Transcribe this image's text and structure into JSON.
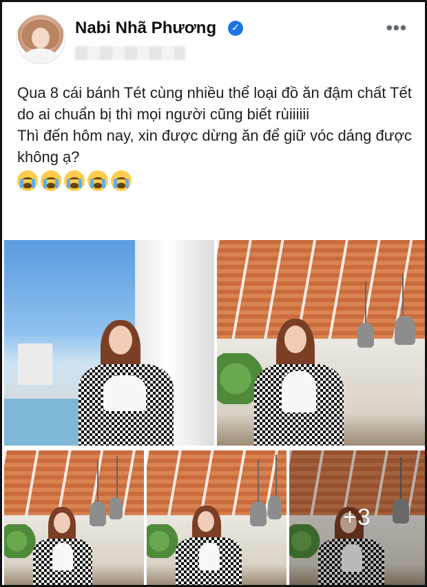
{
  "post": {
    "author_name": "Nabi Nhã Phương",
    "verified_glyph": "✓",
    "more_glyph": "•••",
    "text_lines": [
      "Qua 8 cái bánh Tét cùng nhiều thể loại đồ ăn đậm chất Tết do ai chuẩn bị thì mọi người cũng biết rùiiiiii",
      "Thì đến hôm nay, xin được dừng ăn để giữ vóc dáng được không ạ?"
    ],
    "emoji_count": 5,
    "emoji_name": "loudly-crying-face-emoji"
  },
  "gallery": {
    "more_photos_label": "+3"
  },
  "colors": {
    "verified_blue": "#1b74e4",
    "text": "#1c1e21",
    "muted": "#606770"
  }
}
